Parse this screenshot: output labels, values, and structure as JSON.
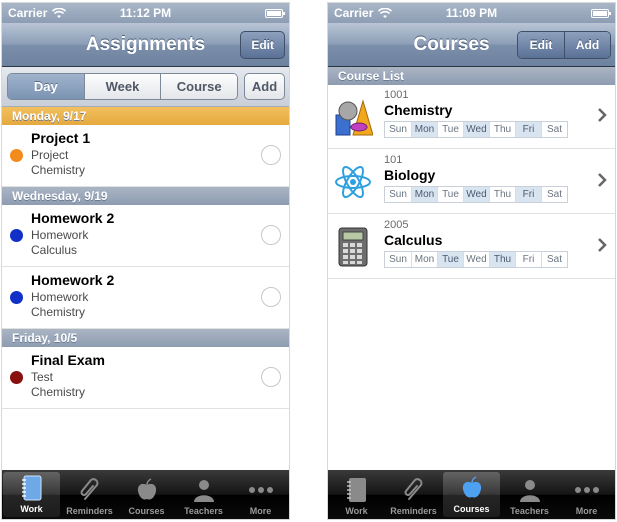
{
  "status_left": {
    "carrier": "Carrier",
    "time": "11:12 PM"
  },
  "status_right": {
    "carrier": "Carrier",
    "time": "11:09 PM"
  },
  "assignments": {
    "title": "Assignments",
    "edit_label": "Edit",
    "segments": [
      "Day",
      "Week",
      "Course"
    ],
    "active_segment": "Day",
    "add_label": "Add",
    "sections": [
      {
        "header": "Monday, 9/17",
        "highlight": true,
        "items": [
          {
            "title": "Project 1",
            "type": "Project",
            "course": "Chemistry",
            "color": "#f28a1c"
          }
        ]
      },
      {
        "header": "Wednesday, 9/19",
        "highlight": false,
        "items": [
          {
            "title": "Homework 2",
            "type": "Homework",
            "course": "Calculus",
            "color": "#1030c8"
          },
          {
            "title": "Homework 2",
            "type": "Homework",
            "course": "Chemistry",
            "color": "#1030c8"
          }
        ]
      },
      {
        "header": "Friday, 10/5",
        "highlight": false,
        "items": [
          {
            "title": "Final Exam",
            "type": "Test",
            "course": "Chemistry",
            "color": "#8a0f0f"
          }
        ]
      }
    ]
  },
  "courses": {
    "title": "Courses",
    "edit_label": "Edit",
    "add_label": "Add",
    "list_header": "Course List",
    "day_labels": [
      "Sun",
      "Mon",
      "Tue",
      "Wed",
      "Thu",
      "Fri",
      "Sat"
    ],
    "items": [
      {
        "code": "1001",
        "name": "Chemistry",
        "icon": "chemistry-shapes-icon",
        "days_on": [
          "Mon",
          "Wed",
          "Fri"
        ]
      },
      {
        "code": "101",
        "name": "Biology",
        "icon": "atom-icon",
        "days_on": [
          "Mon",
          "Wed",
          "Fri"
        ]
      },
      {
        "code": "2005",
        "name": "Calculus",
        "icon": "calculator-icon",
        "days_on": [
          "Tue",
          "Thu"
        ]
      }
    ]
  },
  "tabbar": {
    "items": [
      {
        "label": "Work",
        "icon": "notebook-icon"
      },
      {
        "label": "Reminders",
        "icon": "paperclip-icon"
      },
      {
        "label": "Courses",
        "icon": "apple-icon"
      },
      {
        "label": "Teachers",
        "icon": "person-icon"
      },
      {
        "label": "More",
        "icon": "more-dots-icon"
      }
    ],
    "active_left": "Work",
    "active_right": "Courses"
  },
  "colors": {
    "today_header": "#e5a93e",
    "section_header": "#8e9cb1",
    "navbar": "#7c8faa"
  }
}
